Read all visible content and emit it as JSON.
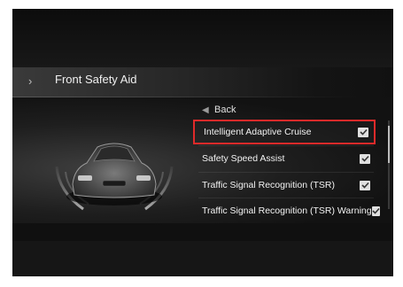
{
  "header": {
    "title": "Front Safety Aid",
    "chevron_icon": "chevron-right-icon"
  },
  "menu": {
    "back_label": "Back",
    "back_icon": "back-arrow-icon",
    "items": [
      {
        "label": "Intelligent Adaptive Cruise",
        "checked": true,
        "selected": true
      },
      {
        "label": "Safety Speed Assist",
        "checked": true,
        "selected": false
      },
      {
        "label": "Traffic Signal Recognition (TSR)",
        "checked": true,
        "selected": false
      },
      {
        "label": "Traffic Signal Recognition (TSR) Warning",
        "checked": true,
        "selected": false
      }
    ]
  },
  "colors": {
    "selection_outline": "#e02a2a",
    "background": "#101010",
    "text": "#f2f2f2"
  }
}
